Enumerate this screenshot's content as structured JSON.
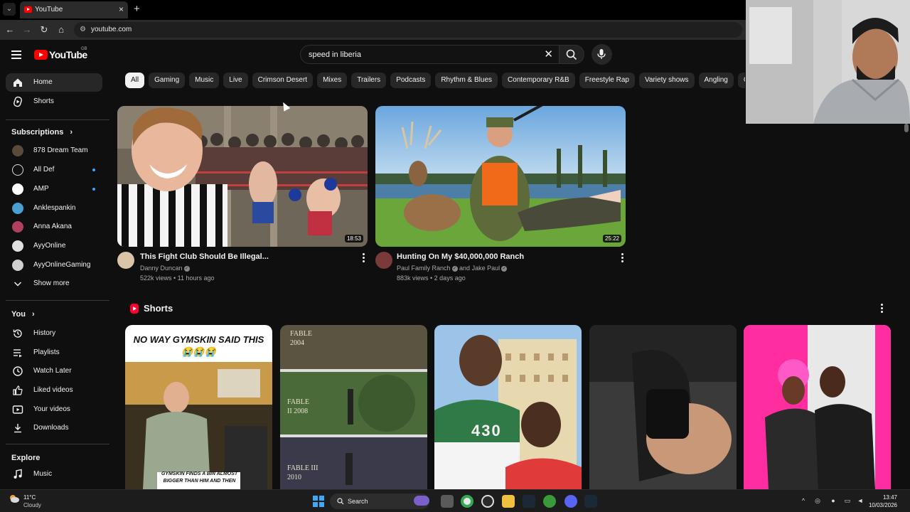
{
  "browser": {
    "tab_title": "YouTube",
    "tab_close": "×",
    "new_tab": "+",
    "url": "youtube.com"
  },
  "masthead": {
    "logo_text": "YouTube",
    "region": "GB",
    "search_value": "speed in liberia",
    "clear": "✕"
  },
  "sidebar": {
    "main": [
      {
        "label": "Home",
        "icon": "home-icon"
      },
      {
        "label": "Shorts",
        "icon": "shorts-icon"
      }
    ],
    "subscriptions_title": "Subscriptions",
    "subscriptions_chevron": "›",
    "subscriptions": [
      {
        "label": "878 Dream Team",
        "color": "#5a4a3a",
        "dot": false
      },
      {
        "label": "All Def",
        "color": "#111111",
        "dot": true
      },
      {
        "label": "AMP",
        "color": "#ffffff",
        "dot": true
      },
      {
        "label": "Anklespankin",
        "color": "#4aa0d0",
        "dot": false
      },
      {
        "label": "Anna Akana",
        "color": "#b04060",
        "dot": false
      },
      {
        "label": "AyyOnline",
        "color": "#e0e0e0",
        "dot": false
      },
      {
        "label": "AyyOnlineGaming",
        "color": "#cfcfcf",
        "dot": false
      }
    ],
    "show_more": "Show more",
    "you_title": "You",
    "you_chevron": "›",
    "you_items": [
      {
        "label": "History",
        "icon": "history-icon"
      },
      {
        "label": "Playlists",
        "icon": "playlists-icon"
      },
      {
        "label": "Watch Later",
        "icon": "watch-later-icon"
      },
      {
        "label": "Liked videos",
        "icon": "thumbs-up-icon"
      },
      {
        "label": "Your videos",
        "icon": "your-videos-icon"
      },
      {
        "label": "Downloads",
        "icon": "download-icon"
      }
    ],
    "explore_title": "Explore",
    "explore_items": [
      {
        "label": "Music",
        "icon": "music-icon"
      }
    ]
  },
  "chips": [
    "All",
    "Gaming",
    "Music",
    "Live",
    "Crimson Desert",
    "Mixes",
    "Trailers",
    "Podcasts",
    "Rhythm & Blues",
    "Contemporary R&B",
    "Freestyle Rap",
    "Variety shows",
    "Angling",
    "Co"
  ],
  "videos": [
    {
      "title": "This Fight Club Should Be Illegal...",
      "channel": "Danny Duncan",
      "verified": "✓",
      "meta": "522k views • 11 hours ago",
      "duration": "18:53"
    },
    {
      "title": "Hunting On My $40,000,000 Ranch",
      "channel": "Paul Family Ranch",
      "channel_join": "and Jake Paul",
      "verified": "✓",
      "meta": "883k views • 2 days ago",
      "duration": "25:22"
    }
  ],
  "shorts": {
    "title": "Shorts",
    "items": [
      {
        "top_text": "NO WAY GYMSKIN SAID THIS 😭😭😭",
        "bottom_text": "GYMSKIN FINDS A BIN ALMOST BIGGER THAN HIM AND THEN"
      },
      {
        "labels": [
          "FABLE 2004",
          "FABLE II 2008",
          "FABLE III 2010"
        ]
      },
      {
        "shirt_text": "430"
      },
      {},
      {}
    ]
  },
  "taskbar": {
    "temp": "11°C",
    "condition": "Cloudy",
    "search_label": "Search",
    "time": "13:47",
    "date": "10/03/2026"
  }
}
